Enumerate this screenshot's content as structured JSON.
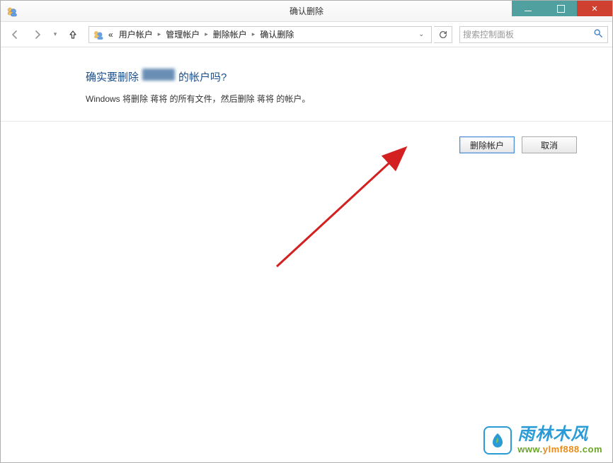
{
  "window": {
    "title": "确认删除"
  },
  "breadcrumb": {
    "prefix": "«",
    "items": [
      "用户帐户",
      "管理帐户",
      "删除帐户",
      "确认删除"
    ]
  },
  "search": {
    "placeholder": "搜索控制面板"
  },
  "main": {
    "heading_prefix": "确实要删除",
    "heading_suffix": "的帐户吗?",
    "body": "Windows 将删除 蒋将 的所有文件，然后删除 蒋将 的帐户。"
  },
  "buttons": {
    "primary": "删除帐户",
    "cancel": "取消"
  },
  "watermark": {
    "name": "雨林木风",
    "url": "www.ylmf888.com"
  }
}
